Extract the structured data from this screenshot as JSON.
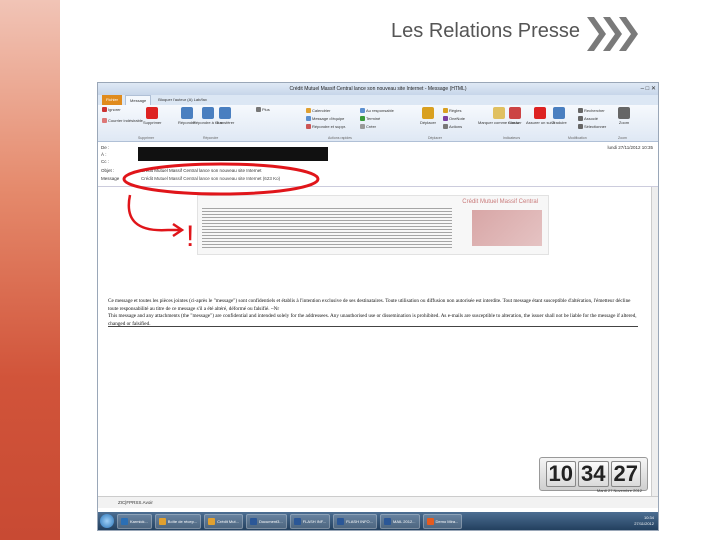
{
  "slide": {
    "title": "Les Relations Presse"
  },
  "window": {
    "title": "Crédit Mutuel Massif Central lance son nouveau site Internet - Message (HTML)",
    "controls": "–  □  ✕"
  },
  "ribbon": {
    "tabs": [
      "Fichier",
      "Message",
      "Bloquer l'auteur (A) Lab/fax"
    ],
    "buttons": [
      {
        "label": "Ignorer",
        "icon": "ignore-icon",
        "color": "#c33"
      },
      {
        "label": "Courrier indésirable",
        "icon": "junk-icon",
        "color": "#d77"
      },
      {
        "label": "Supprimer",
        "icon": "delete-x-icon",
        "color": "#d22"
      },
      {
        "label": "Répondre",
        "icon": "reply-icon",
        "color": "#4a7fc0"
      },
      {
        "label": "Répondre à tous",
        "icon": "reply-all-icon",
        "color": "#4a7fc0"
      },
      {
        "label": "Transférer",
        "icon": "forward-icon",
        "color": "#4a7fc0"
      },
      {
        "label": "Plus",
        "icon": "more-icon",
        "color": "#777"
      },
      {
        "label": "Calendrier",
        "icon": "calendar-icon",
        "color": "#e0a030"
      },
      {
        "label": "Message d'équipe",
        "icon": "team-message-icon",
        "color": "#5b8fd0"
      },
      {
        "label": "Répondre et suppr.",
        "icon": "reply-delete-icon",
        "color": "#c55"
      },
      {
        "label": "Au responsable",
        "icon": "manager-icon",
        "color": "#5b8fd0"
      },
      {
        "label": "Terminé",
        "icon": "done-icon",
        "color": "#3a9a3a"
      },
      {
        "label": "Créer",
        "icon": "create-icon",
        "color": "#999"
      },
      {
        "label": "Déplacer",
        "icon": "move-icon",
        "color": "#d9a020"
      },
      {
        "label": "Règles",
        "icon": "rules-icon",
        "color": "#d9a020"
      },
      {
        "label": "OneNote",
        "icon": "onenote-icon",
        "color": "#7b3fa0"
      },
      {
        "label": "Actions",
        "icon": "actions-icon",
        "color": "#777"
      },
      {
        "label": "Marquer comme non lu",
        "icon": "mark-unread-icon",
        "color": "#e0c060"
      },
      {
        "label": "Classer",
        "icon": "categorize-icon",
        "color": "#c44"
      },
      {
        "label": "Assurer un suivi",
        "icon": "follow-up-flag-icon",
        "color": "#d22"
      },
      {
        "label": "Traduire",
        "icon": "translate-icon",
        "color": "#4a7fc0"
      },
      {
        "label": "Rechercher",
        "icon": "find-icon",
        "color": "#666"
      },
      {
        "label": "Associé",
        "icon": "related-icon",
        "color": "#666"
      },
      {
        "label": "Sélectionner",
        "icon": "select-icon",
        "color": "#666"
      },
      {
        "label": "Zoom",
        "icon": "zoom-icon",
        "color": "#666"
      }
    ],
    "groups": [
      "Supprimer",
      "Répondre",
      "Actions rapides",
      "Déplacer",
      "Indicateurs",
      "Modification",
      "Zoom"
    ]
  },
  "header": {
    "from_label": "De :",
    "to_label": "À :",
    "cc_label": "Cc :",
    "subject_label": "Objet :",
    "subject": "Crédit Mutuel Massif Central lance son nouveau site Internet",
    "attachment_label": "Message",
    "attachment": "Crédit Mutuel Massif Central lance son nouveau site Internet (623 Ko)",
    "date": "lundi 27/11/2012 10:35"
  },
  "body": {
    "newsletter_title": "Crédit Mutuel Massif Central",
    "disclaimer_fr": "Ce message et toutes les pièces jointes (ci-après le \"message\") sont confidentiels et établis à l'intention exclusive de ses destinataires. Toute utilisation ou diffusion non autorisée est interdite. Tout message étant susceptible d'altération, l'émetteur décline toute responsabilité au titre de ce message s'il a été altéré, déformé ou falsifié. ~Nr",
    "disclaimer_en": "This message and any attachments (the \"message\") are confidential and intended solely for the addressees. Any unauthorised use or dissemination is prohibited. As e-mails are susceptible to alteration, the issuer shall not be liable for the message if altered, changed or falsified."
  },
  "annotation": {
    "mark": "!"
  },
  "clock": {
    "h": "10",
    "m": "34",
    "s": "27",
    "date": "Mardi 27 Novembre 2012"
  },
  "attachment_bar": {
    "file": "ZIC|FPRSS.Avoir"
  },
  "taskbar": {
    "items": [
      {
        "label": "Karmick...",
        "color": "#2b6fb5"
      },
      {
        "label": "Boîte de récep...",
        "color": "#e0a030"
      },
      {
        "label": "Crédit Mut...",
        "color": "#e0a030"
      },
      {
        "label": "Document3...",
        "color": "#2b5797"
      },
      {
        "label": "FLASH INF...",
        "color": "#2b5797"
      },
      {
        "label": "FLASH INFO...",
        "color": "#2b5797"
      },
      {
        "label": "MAIL 2012...",
        "color": "#2b5797"
      },
      {
        "label": "Demo Mira...",
        "color": "#e55b1f"
      }
    ],
    "time": "10:34",
    "date": "27/11/2012"
  }
}
